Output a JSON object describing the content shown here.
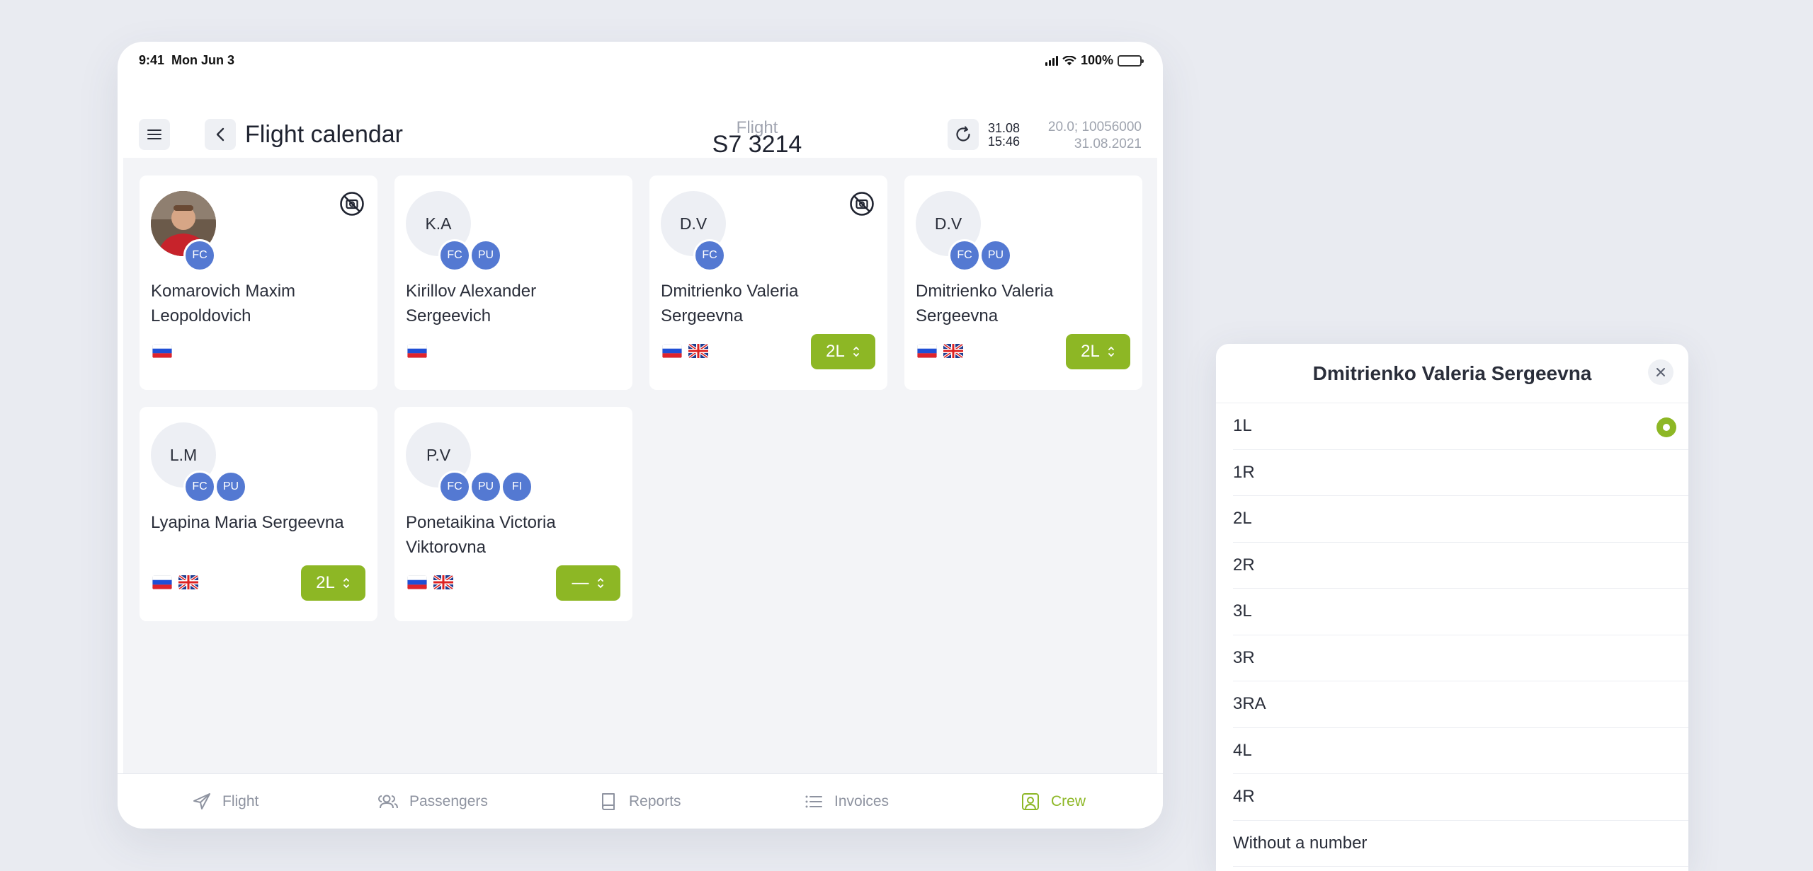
{
  "status_bar": {
    "time": "9:41",
    "date": "Mon Jun 3",
    "battery": "100%"
  },
  "header": {
    "title": "Flight calendar",
    "flight_label": "Flight",
    "flight_number": "S7 3214",
    "sync_date": "31.08",
    "sync_time": "15:46",
    "info_line1": "20.0; 10056000",
    "info_line2": "31.08.2021"
  },
  "crew": [
    {
      "initials": "",
      "has_photo": true,
      "badges": [
        "FC"
      ],
      "name": "Komarovich Maxim Leopoldovich",
      "flags": [
        "ru"
      ],
      "no_photo_icon": true,
      "seat": null
    },
    {
      "initials": "K.A",
      "has_photo": false,
      "badges": [
        "FC",
        "PU"
      ],
      "name": "Kirillov Alexander Sergeevich",
      "flags": [
        "ru"
      ],
      "no_photo_icon": false,
      "seat": null
    },
    {
      "initials": "D.V",
      "has_photo": false,
      "badges": [
        "FC"
      ],
      "name": "Dmitrienko Valeria Sergeevna",
      "flags": [
        "ru",
        "gb"
      ],
      "no_photo_icon": true,
      "seat": "2L"
    },
    {
      "initials": "D.V",
      "has_photo": false,
      "badges": [
        "FC",
        "PU"
      ],
      "name": "Dmitrienko Valeria Sergeevna",
      "flags": [
        "ru",
        "gb"
      ],
      "no_photo_icon": false,
      "seat": "2L"
    },
    {
      "initials": "L.M",
      "has_photo": false,
      "badges": [
        "FC",
        "PU"
      ],
      "name": "Lyapina Maria Sergeevna",
      "flags": [
        "ru",
        "gb"
      ],
      "no_photo_icon": false,
      "seat": "2L"
    },
    {
      "initials": "P.V",
      "has_photo": false,
      "badges": [
        "FC",
        "PU",
        "FI"
      ],
      "name": "Ponetaikina Victoria Viktorovna",
      "flags": [
        "ru",
        "gb"
      ],
      "no_photo_icon": false,
      "seat": "—"
    }
  ],
  "tabs": [
    {
      "label": "Flight",
      "icon": "plane-icon",
      "active": false
    },
    {
      "label": "Passengers",
      "icon": "passengers-icon",
      "active": false
    },
    {
      "label": "Reports",
      "icon": "book-icon",
      "active": false
    },
    {
      "label": "Invoices",
      "icon": "list-icon",
      "active": false
    },
    {
      "label": "Crew",
      "icon": "crew-icon",
      "active": true
    }
  ],
  "sheet": {
    "title": "Dmitrienko Valeria Sergeevna",
    "selected": "1L",
    "options": [
      "1L",
      "1R",
      "2L",
      "2R",
      "3L",
      "3R",
      "3RA",
      "4L",
      "4R",
      "Without a number"
    ]
  },
  "colors": {
    "accent": "#8db725",
    "badge": "#5479d2",
    "background": "#e9ebf1",
    "content_bg": "#f3f4f7"
  }
}
